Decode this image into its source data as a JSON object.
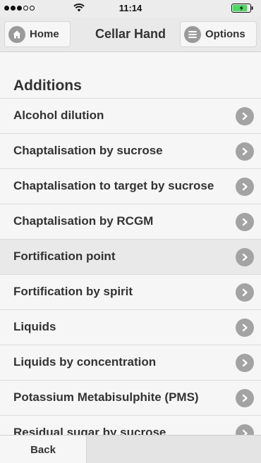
{
  "status_bar": {
    "signal_dots_filled": 3,
    "signal_dots_total": 5,
    "time": "11:14",
    "battery_level": 0.85,
    "battery_color": "#4cd964",
    "charging": true
  },
  "header": {
    "home_label": "Home",
    "title": "Cellar Hand",
    "options_label": "Options"
  },
  "section": {
    "heading": "Additions",
    "items": [
      {
        "label": "Alcohol dilution",
        "highlighted": false
      },
      {
        "label": "Chaptalisation by sucrose",
        "highlighted": false
      },
      {
        "label": "Chaptalisation to target by sucrose",
        "highlighted": false
      },
      {
        "label": "Chaptalisation by RCGM",
        "highlighted": false
      },
      {
        "label": "Fortification point",
        "highlighted": true
      },
      {
        "label": "Fortification by spirit",
        "highlighted": false
      },
      {
        "label": "Liquids",
        "highlighted": false
      },
      {
        "label": "Liquids by concentration",
        "highlighted": false
      },
      {
        "label": "Potassium Metabisulphite (PMS)",
        "highlighted": false
      },
      {
        "label": "Residual sugar by sucrose",
        "highlighted": false
      }
    ]
  },
  "footer": {
    "back_label": "Back"
  }
}
